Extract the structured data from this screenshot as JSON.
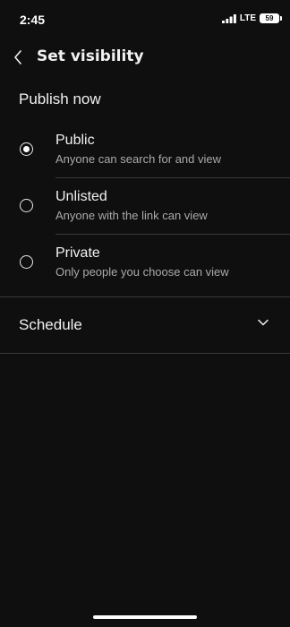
{
  "status_bar": {
    "time": "2:45",
    "network": "LTE",
    "battery": "59"
  },
  "header": {
    "title": "Set visibility"
  },
  "publish_section": {
    "title": "Publish now",
    "options": [
      {
        "label": "Public",
        "description": "Anyone can search for and view",
        "selected": true
      },
      {
        "label": "Unlisted",
        "description": "Anyone with the link can view",
        "selected": false
      },
      {
        "label": "Private",
        "description": "Only people you choose can view",
        "selected": false
      }
    ]
  },
  "schedule": {
    "label": "Schedule"
  }
}
